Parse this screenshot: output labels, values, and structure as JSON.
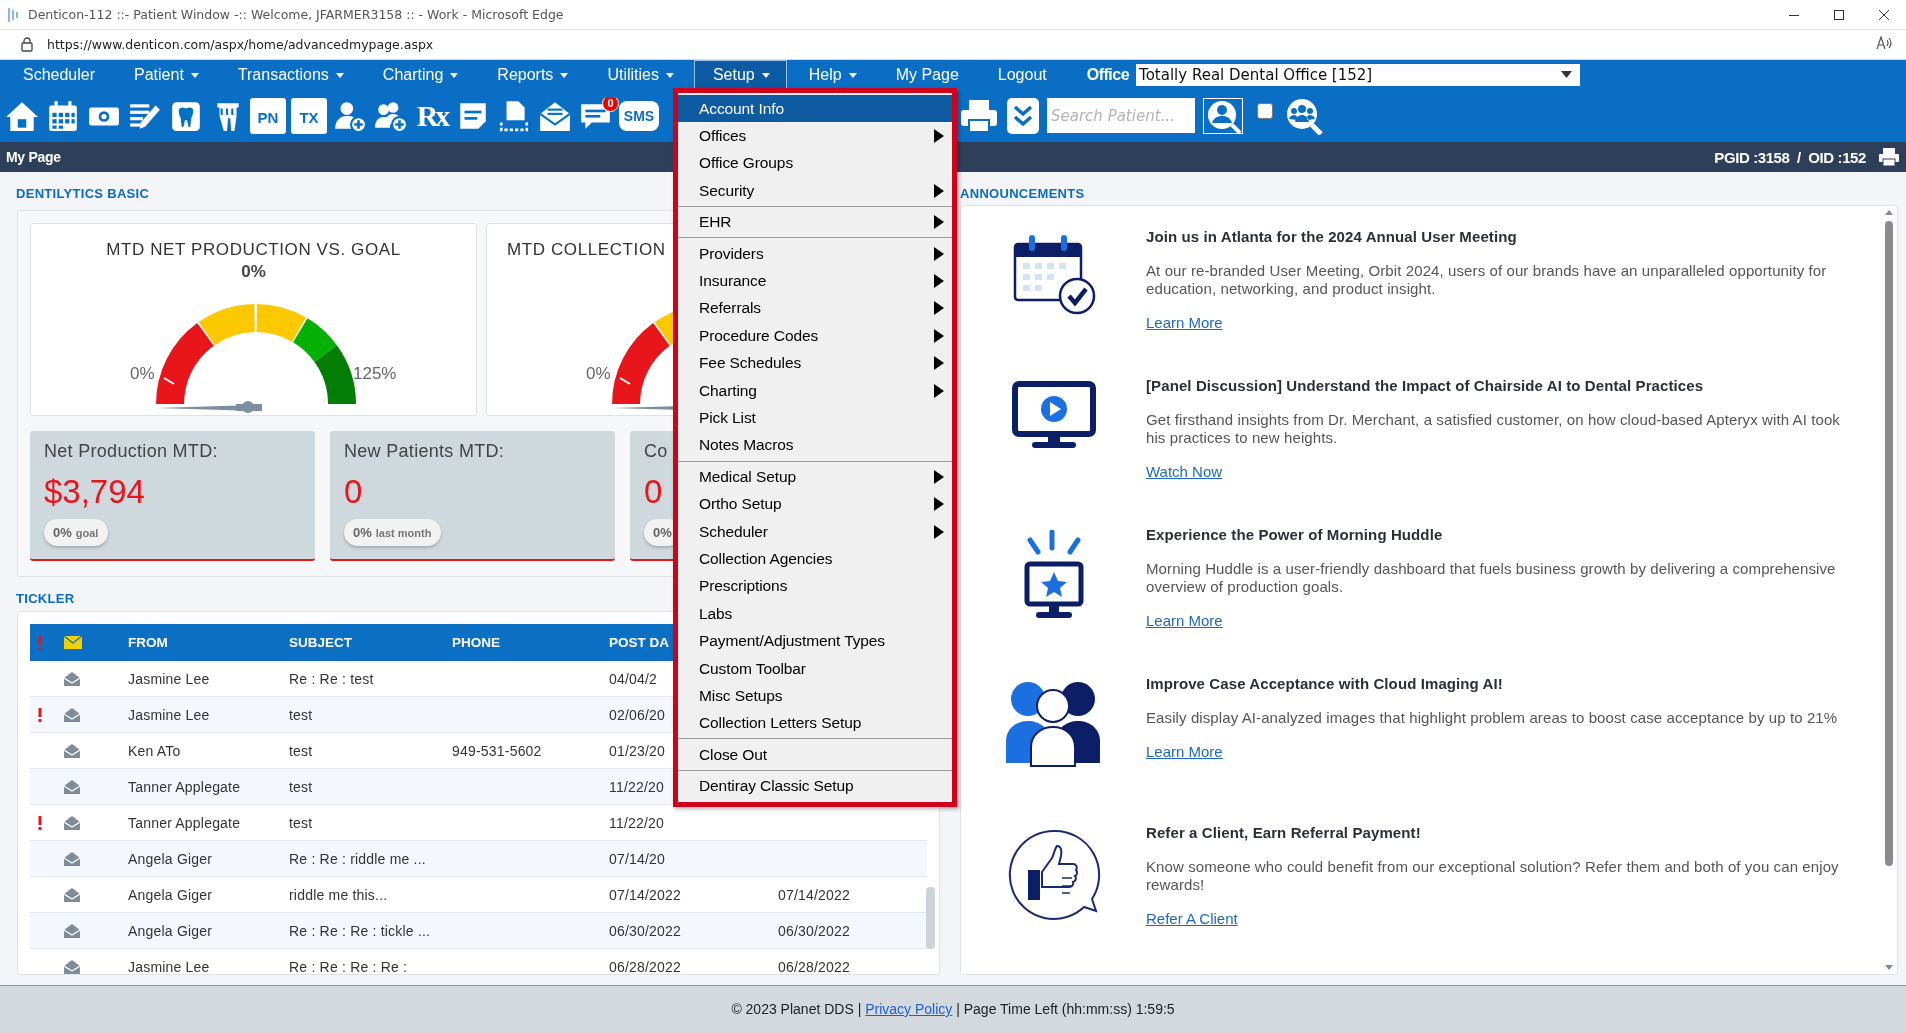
{
  "window": {
    "title": "Denticon-112 ::- Patient Window -:: Welcome, JFARMER3158 :: - Work - Microsoft Edge"
  },
  "address_bar": {
    "url": "https://www.denticon.com/aspx/home/advancedmypage.aspx"
  },
  "nav": {
    "items": [
      {
        "label": "Scheduler",
        "has_dropdown": false,
        "selected": false
      },
      {
        "label": "Patient",
        "has_dropdown": true,
        "selected": false
      },
      {
        "label": "Transactions",
        "has_dropdown": true,
        "selected": false
      },
      {
        "label": "Charting",
        "has_dropdown": true,
        "selected": false
      },
      {
        "label": "Reports",
        "has_dropdown": true,
        "selected": false
      },
      {
        "label": "Utilities",
        "has_dropdown": true,
        "selected": false
      },
      {
        "label": "Setup",
        "has_dropdown": true,
        "selected": true
      },
      {
        "label": "Help",
        "has_dropdown": true,
        "selected": false
      },
      {
        "label": "My Page",
        "has_dropdown": false,
        "selected": false
      },
      {
        "label": "Logout",
        "has_dropdown": false,
        "selected": false
      }
    ],
    "office": {
      "label": "Office",
      "value": "Totally Real Dental Office [152]"
    }
  },
  "toolbar": {
    "buttons": [
      {
        "kind": "icon"
      },
      {
        "kind": "icon"
      },
      {
        "kind": "icon"
      },
      {
        "kind": "icon"
      },
      {
        "kind": "icon"
      },
      {
        "kind": "icon"
      },
      {
        "kind": "label",
        "label": "PN"
      },
      {
        "kind": "label",
        "label": "TX"
      },
      {
        "kind": "icon"
      },
      {
        "kind": "icon"
      },
      {
        "kind": "label",
        "label": "Rx"
      },
      {
        "kind": "icon"
      },
      {
        "kind": "icon"
      },
      {
        "kind": "icon"
      },
      {
        "kind": "icon",
        "badge": "0"
      },
      {
        "kind": "label",
        "label": "SMS"
      }
    ],
    "search": {
      "placeholder": "Search Patient..."
    },
    "checkbox": {
      "checked": false
    }
  },
  "page_bar": {
    "title": "My Page",
    "ids": "PGID :3158  /  OID :152"
  },
  "dentilytics": {
    "title": "DENTILYTICS BASIC",
    "gauges": [
      {
        "title": "MTD NET PRODUCTION VS. GOAL",
        "value": "0%",
        "min": "0%",
        "max": "125%"
      },
      {
        "title": "MTD COLLECTION",
        "min": "0%"
      }
    ],
    "kpis": [
      {
        "title": "Net Production MTD:",
        "value": "$3,794",
        "badge_value": "0%",
        "badge_label": "goal"
      },
      {
        "title": "New Patients MTD:",
        "value": "0",
        "badge_value": "0%",
        "badge_label": "last month"
      },
      {
        "title": "Co",
        "value": "0",
        "badge_value": "0%"
      }
    ]
  },
  "tickler": {
    "title": "TICKLER",
    "columns": [
      "FROM",
      "SUBJECT",
      "PHONE",
      "POST DA"
    ],
    "rows": [
      {
        "priority": false,
        "from": "Jasmine Lee",
        "subject": "Re : Re : test",
        "post_date": "04/04/2"
      },
      {
        "priority": true,
        "from": "Jasmine Lee",
        "subject": "test",
        "post_date": "02/06/20"
      },
      {
        "priority": false,
        "from": "Ken ATo",
        "subject": "test",
        "phone": "949-531-5602",
        "post_date": "01/23/20"
      },
      {
        "priority": false,
        "from": "Tanner Applegate",
        "subject": "test",
        "post_date": "11/22/20"
      },
      {
        "priority": true,
        "from": "Tanner Applegate",
        "subject": "test",
        "post_date": "11/22/20"
      },
      {
        "priority": false,
        "from": "Angela Giger",
        "subject": "Re : Re : riddle me ...",
        "post_date": "07/14/20"
      },
      {
        "priority": false,
        "from": "Angela Giger",
        "subject": "riddle me this...",
        "post_date": "07/14/2022",
        "column_5": "07/14/2022"
      },
      {
        "priority": false,
        "from": "Angela Giger",
        "subject": "Re : Re : Re : tickle ...",
        "post_date": "06/30/2022",
        "column_5": "06/30/2022"
      },
      {
        "priority": false,
        "from": "Jasmine Lee",
        "subject": "Re : Re : Re : Re :",
        "post_date": "06/28/2022",
        "column_5": "06/28/2022"
      }
    ]
  },
  "setup_menu": {
    "groups": [
      [
        {
          "label": "Account Info",
          "has_submenu": false,
          "selected": true
        },
        {
          "label": "Offices",
          "has_submenu": true,
          "selected": false
        },
        {
          "label": "Office Groups",
          "has_submenu": false,
          "selected": false
        },
        {
          "label": "Security",
          "has_submenu": true,
          "selected": false
        }
      ],
      [
        {
          "label": "EHR",
          "has_submenu": true,
          "selected": false
        }
      ],
      [
        {
          "label": "Providers",
          "has_submenu": true,
          "selected": false
        },
        {
          "label": "Insurance",
          "has_submenu": true,
          "selected": false
        },
        {
          "label": "Referrals",
          "has_submenu": true,
          "selected": false
        },
        {
          "label": "Procedure Codes",
          "has_submenu": true,
          "selected": false
        },
        {
          "label": "Fee Schedules",
          "has_submenu": true,
          "selected": false
        },
        {
          "label": "Charting",
          "has_submenu": true,
          "selected": false
        },
        {
          "label": "Pick List",
          "has_submenu": false,
          "selected": false
        },
        {
          "label": "Notes Macros",
          "has_submenu": false,
          "selected": false
        }
      ],
      [
        {
          "label": "Medical Setup",
          "has_submenu": true,
          "selected": false
        },
        {
          "label": "Ortho Setup",
          "has_submenu": true,
          "selected": false
        },
        {
          "label": "Scheduler",
          "has_submenu": true,
          "selected": false
        },
        {
          "label": "Collection Agencies",
          "has_submenu": false,
          "selected": false
        },
        {
          "label": "Prescriptions",
          "has_submenu": false,
          "selected": false
        },
        {
          "label": "Labs",
          "has_submenu": false,
          "selected": false
        },
        {
          "label": "Payment/Adjustment Types",
          "has_submenu": false,
          "selected": false
        },
        {
          "label": "Custom Toolbar",
          "has_submenu": false,
          "selected": false
        },
        {
          "label": "Misc Setups",
          "has_submenu": false,
          "selected": false
        },
        {
          "label": "Collection Letters Setup",
          "has_submenu": false,
          "selected": false
        }
      ],
      [
        {
          "label": "Close Out",
          "has_submenu": false,
          "selected": false
        }
      ],
      [
        {
          "label": "Dentiray Classic Setup",
          "has_submenu": false,
          "selected": false
        }
      ]
    ]
  },
  "announcements": {
    "title": "ANNOUNCEMENTS",
    "items": [
      {
        "title": "Join us in Atlanta for the 2024 Annual User Meeting",
        "body": "At our re-branded User Meeting, Orbit 2024, users of our brands have an unparalleled opportunity for education, networking, and product insight.",
        "link": "Learn More"
      },
      {
        "title": "[Panel Discussion] Understand the Impact of Chairside AI to Dental Practices",
        "body": "Get firsthand insights from Dr. Merchant, a satisfied customer, on how cloud-based Apteryx with AI took his practices to new heights.",
        "link": "Watch Now"
      },
      {
        "title": "Experience the Power of Morning Huddle",
        "body": "Morning Huddle is a user-friendly dashboard that fuels business growth by delivering a comprehensive overview of production goals.",
        "link": "Learn More"
      },
      {
        "title": "Improve Case Acceptance with Cloud Imaging AI!",
        "body": "Easily display AI-analyzed images that highlight problem areas to boost case acceptance by up to 21%",
        "link": "Learn More"
      },
      {
        "title": "Refer a Client, Earn Referral Payment!",
        "body": "Know someone who could benefit from our exceptional solution? Refer them and both of you can enjoy rewards!",
        "link": "Refer A Client"
      }
    ]
  },
  "footer": {
    "prefix": "© 2023 Planet DDS |",
    "link": "Privacy Policy",
    "suffix": "| Page Time Left (hh:mm:ss) 1:59:5"
  }
}
